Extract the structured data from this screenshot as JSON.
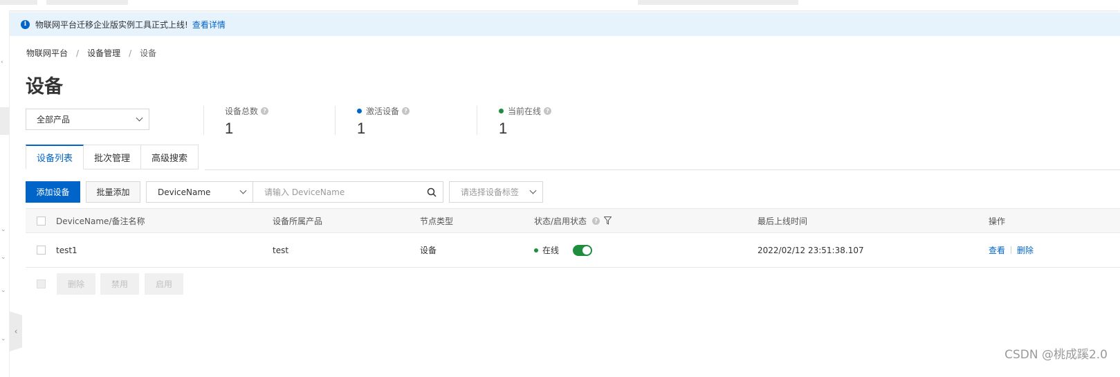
{
  "notice": {
    "text": "物联网平台迁移企业版实例工具正式上线!",
    "link": "查看详情"
  },
  "breadcrumb": [
    "物联网平台",
    "设备管理",
    "设备"
  ],
  "breadcrumb_sep": "/",
  "page_title": "设备",
  "product_select": {
    "value": "全部产品"
  },
  "stats": [
    {
      "label": "设备总数",
      "value": "1",
      "dot_color": ""
    },
    {
      "label": "激活设备",
      "value": "1",
      "dot_color": "#0064c8"
    },
    {
      "label": "当前在线",
      "value": "1",
      "dot_color": "#1e8e3e"
    }
  ],
  "tabs": [
    "设备列表",
    "批次管理",
    "高级搜索"
  ],
  "toolbar": {
    "add_device": "添加设备",
    "batch_add": "批量添加",
    "field_select": "DeviceName",
    "search_placeholder": "请输入 DeviceName",
    "tag_placeholder": "请选择设备标签"
  },
  "table": {
    "columns": [
      "DeviceName/备注名称",
      "设备所属产品",
      "节点类型",
      "状态/启用状态",
      "最后上线时间",
      "操作"
    ],
    "rows": [
      {
        "name": "test1",
        "product": "test",
        "node_type": "设备",
        "status": "在线",
        "enabled": true,
        "last_online": "2022/02/12 23:51:38.107",
        "actions": [
          "查看",
          "删除"
        ]
      }
    ]
  },
  "batch_actions": [
    "删除",
    "禁用",
    "启用"
  ],
  "colors": {
    "primary": "#0064c8",
    "online": "#1e8e3e",
    "notice_bg": "#e6f2fc"
  },
  "watermark": "CSDN @桃成蹊2.0"
}
